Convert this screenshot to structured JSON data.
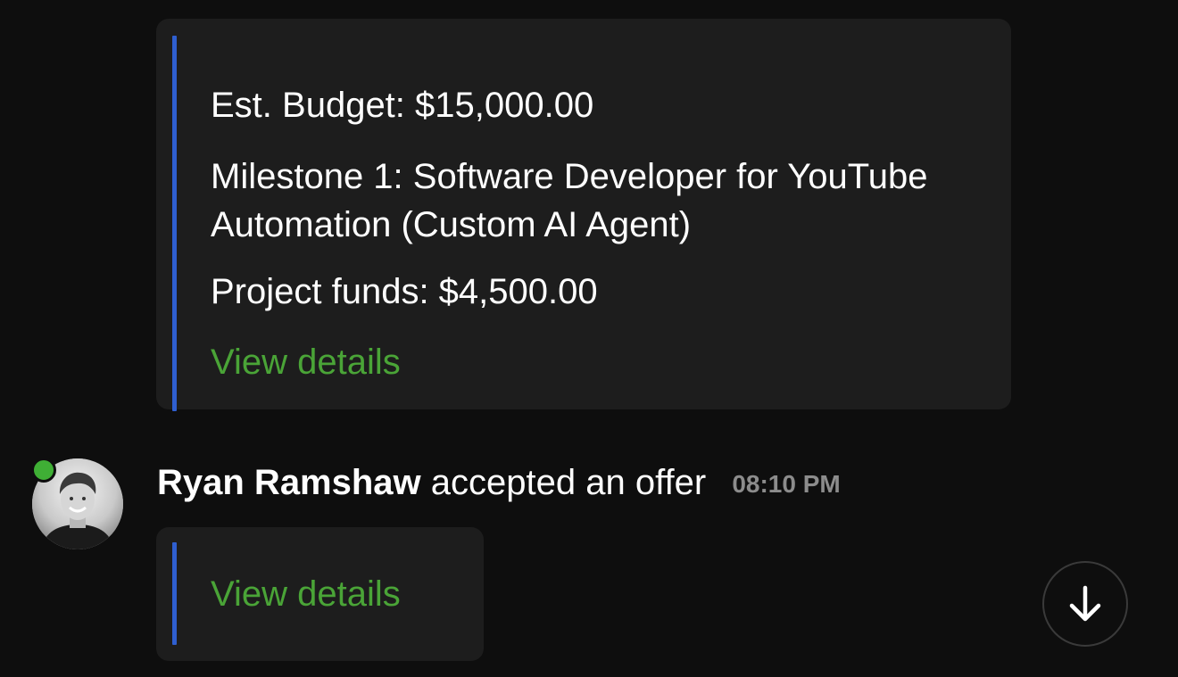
{
  "offer_card": {
    "budget": "Est. Budget: $15,000.00",
    "milestone": "Milestone 1: Software Developer for YouTube Automation (Custom AI Agent)",
    "funds": "Project funds: $4,500.00",
    "link_label": "View details"
  },
  "event": {
    "user_name": "Ryan Ramshaw",
    "action": "accepted an offer",
    "time": "08:10 PM",
    "user_online": true,
    "status_color": "#3faf35"
  },
  "accept_card": {
    "link_label": "View details"
  },
  "colors": {
    "link": "#4aa437",
    "accent_bar": "#2f5fd0",
    "card_bg": "#1d1d1d",
    "page_bg": "#0e0e0e"
  },
  "icons": {
    "scroll_button": "arrow-down-icon",
    "avatar": "user-avatar"
  }
}
